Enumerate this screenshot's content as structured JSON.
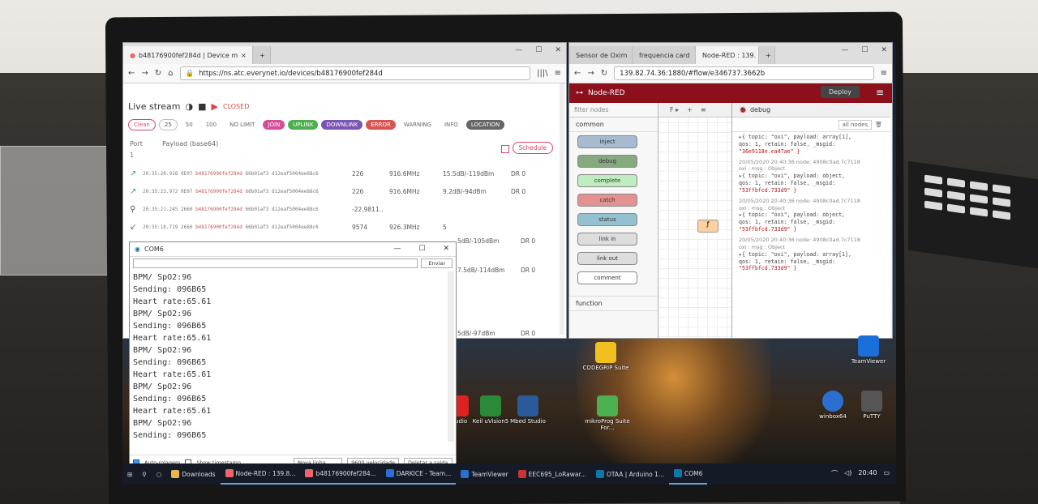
{
  "everynet": {
    "tab_title": "b48176900fef284d | Device m",
    "url": "https://ns.atc.everynet.io/devices/b48176900fef284d",
    "live_stream": "Live stream",
    "status": "CLOSED",
    "chips": [
      "Clean",
      "25",
      "50",
      "100",
      "NO LIMIT",
      "JOIN",
      "UPLINK",
      "DOWNLINK",
      "ERROR",
      "WARNING",
      "INFO",
      "LOCATION"
    ],
    "port_label": "Port",
    "payload_label": "Payload (base64)",
    "port_value": "1",
    "schedule": "Schedule",
    "rows": [
      {
        "time": "20:35:28.928",
        "code": "0E07",
        "dev": "b48176900fef284d",
        "hash": "66b01af3 d12eaf5004ee88c6",
        "c1": "226",
        "c2": "916.6MHz",
        "c3": "15.5dB/-119dBm",
        "c4": "DR 0"
      },
      {
        "time": "20:35:23.972",
        "code": "0E07",
        "dev": "b48176900fef284d",
        "hash": "66b01af3 d12eaf5004ee88c6",
        "c1": "226",
        "c2": "916.6MHz",
        "c3": "9.2dB/-94dBm",
        "c4": "DR 0"
      },
      {
        "time": "20:35:21.245",
        "code": "2660",
        "dev": "b48176900fef284d",
        "hash": "66b01af3 d12eaf5004ee88c6",
        "c1": "-22.9811..",
        "c2": "",
        "c3": "",
        "c4": ""
      },
      {
        "time": "20:35:18.719",
        "code": "2660",
        "dev": "b48176900fef284d",
        "hash": "66b01af3 d12eaf5004ee88c6",
        "c1": "9574",
        "c2": "926.3MHz",
        "c3": "5",
        "c4": ""
      }
    ],
    "extra_right": [
      "5dB/-105dBm",
      "DR 0",
      "7.5dB/-114dBm",
      "DR 0",
      "5dB/-97dBm",
      "DR 0"
    ]
  },
  "nodered": {
    "tabs": [
      "Sensor de Oxim",
      "frequencia card",
      "Node-RED : 139."
    ],
    "url": "139.82.74.36:1880/#flow/e346737.3662b",
    "title": "Node-RED",
    "deploy": "Deploy",
    "filter_placeholder": "filter nodes",
    "category_common": "common",
    "category_function": "function",
    "nodes": [
      "inject",
      "debug",
      "complete",
      "catch",
      "status",
      "link in",
      "link out",
      "comment"
    ],
    "debug_tab": "debug",
    "all_nodes": "all nodes",
    "messages": [
      {
        "line1": "▸{ topic: \"oxi\", payload: array[1],",
        "line2": "qos: 1, retain: false, _msgid:",
        "line3": "\"36e9118e.ea47ae\" }"
      },
      {
        "meta": "20/05/2020 20:40:36   node: 4908c0ad.7c7118",
        "sub": "oxi : msg : Object",
        "line1": "▸{ topic: \"oxi\", payload: object,",
        "line2": "qos: 1, retain: false, _msgid:",
        "line3": "\"53ffbfcd.733d9\" }"
      },
      {
        "meta": "20/05/2020 20:40:36   node: 4908c0ad.7c7118",
        "sub": "oxi : msg : Object",
        "line1": "▸{ topic: \"oxi\", payload: object,",
        "line2": "qos: 1, retain: false, _msgid:",
        "line3": "\"53ffbfcd.733d9\" }"
      },
      {
        "meta": "20/05/2020 20:40:36   node: 4908c0ad.7c7118",
        "sub": "oxi : msg : Object",
        "line1": "▸{ topic: \"oxi\", payload: array[1],",
        "line2": "qos: 1, retain: false, _msgid:",
        "line3": "\"53ffbfcd.733d9\" }"
      }
    ]
  },
  "serial": {
    "title": "COM6",
    "send": "Enviar",
    "lines": [
      "BPM/ SpO2:96",
      "Sending: 096B65",
      "Heart rate:65.61",
      "BPM/ SpO2:96",
      "Sending: 096B65",
      "Heart rate:65.61",
      "BPM/ SpO2:96",
      "Sending: 096B65",
      "Heart rate:65.61",
      "BPM/ SpO2:96",
      "Sending: 096B65",
      "Heart rate:65.61",
      "BPM/ SpO2:96",
      "Sending: 096B65"
    ],
    "autoscroll": "Auto-rolagem",
    "timestamp": "Show timestamp",
    "line_ending": "Nova linha",
    "baud": "9600 velocidade",
    "clear": "Deletar a saída"
  },
  "desktop": {
    "icons": [
      "CODEGRIP Suite",
      "TeamViewer",
      "winbox64",
      "PuTTY",
      "Keil uVision5",
      "Mbed Studio",
      "mikroProg Suite For...",
      "Studio"
    ]
  },
  "taskbar": {
    "items": [
      "Downloads",
      "Node-RED : 139.8...",
      "b48176900fef284...",
      "DARKICE - Team...",
      "TeamViewer",
      "EEC695_LoRawar...",
      "OTAA | Arduino 1...",
      "COM6"
    ],
    "clock": "20:40"
  }
}
